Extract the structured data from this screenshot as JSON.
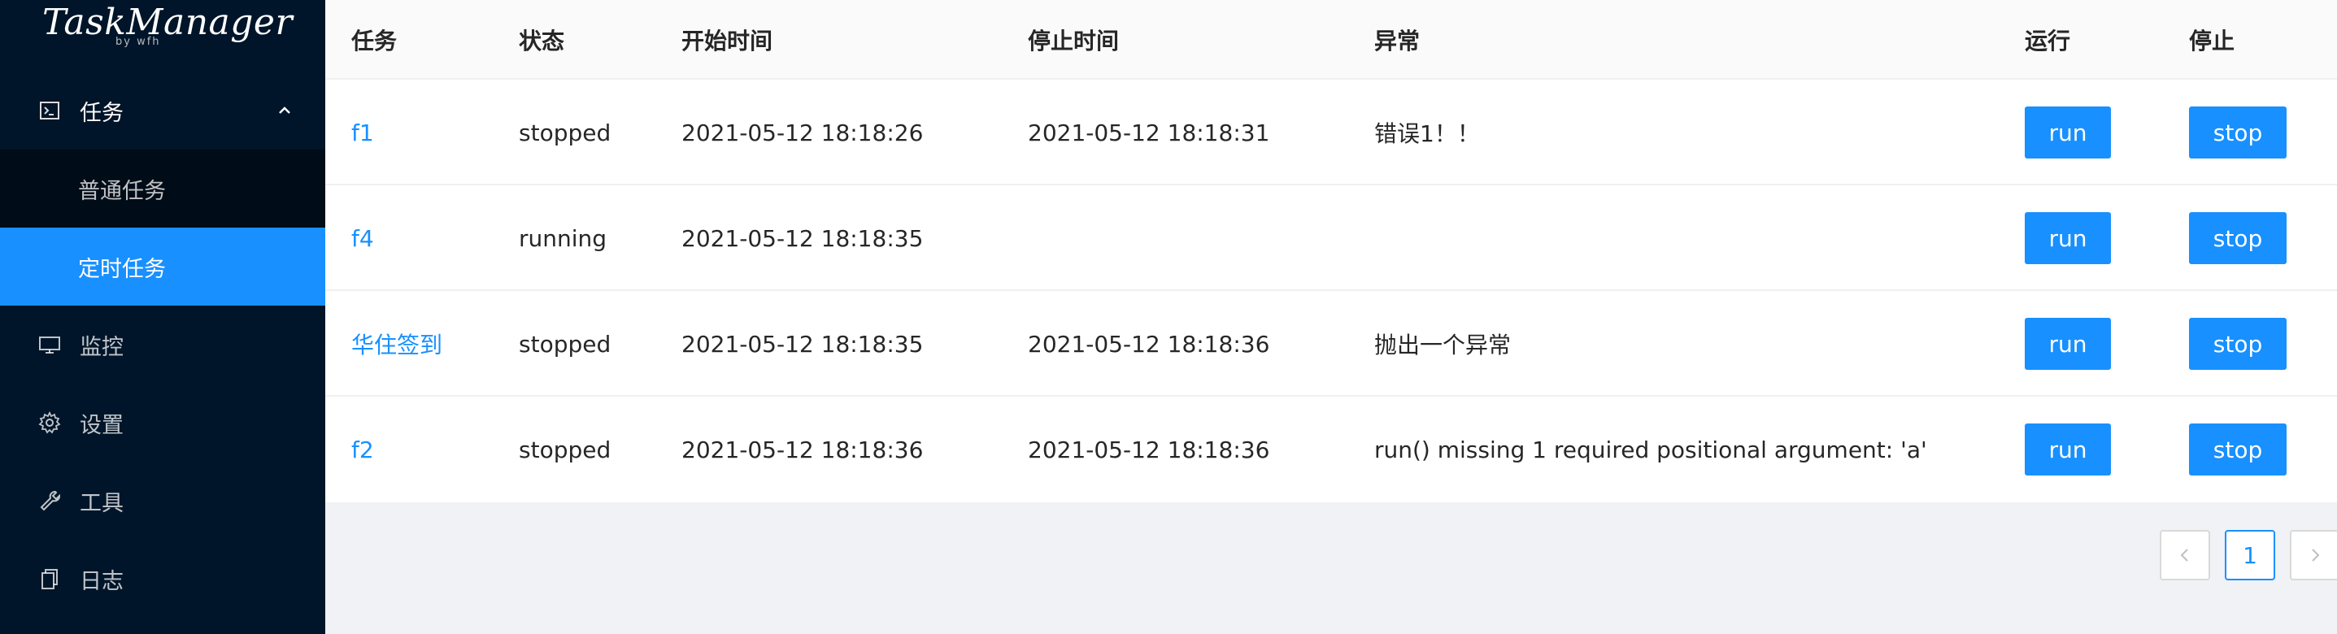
{
  "app": {
    "logo_title": "TaskManager",
    "logo_sub": "by wfh"
  },
  "sidebar": {
    "groups": [
      {
        "label": "任务",
        "icon": "terminal-icon",
        "expanded": true,
        "children": [
          {
            "label": "普通任务",
            "active": false
          },
          {
            "label": "定时任务",
            "active": true
          }
        ]
      },
      {
        "label": "监控",
        "icon": "desktop-icon"
      },
      {
        "label": "设置",
        "icon": "gear-icon"
      },
      {
        "label": "工具",
        "icon": "wrench-icon"
      },
      {
        "label": "日志",
        "icon": "copy-icon"
      }
    ]
  },
  "table": {
    "headers": [
      "任务",
      "状态",
      "开始时间",
      "停止时间",
      "异常",
      "运行",
      "停止"
    ],
    "rows": [
      {
        "task": "f1",
        "status": "stopped",
        "start": "2021-05-12 18:18:26",
        "stop": "2021-05-12 18:18:31",
        "error": "错误1！！",
        "run_label": "run",
        "stop_label": "stop"
      },
      {
        "task": "f4",
        "status": "running",
        "start": "2021-05-12 18:18:35",
        "stop": "",
        "error": "",
        "run_label": "run",
        "stop_label": "stop"
      },
      {
        "task": "华住签到",
        "status": "stopped",
        "start": "2021-05-12 18:18:35",
        "stop": "2021-05-12 18:18:36",
        "error": "抛出一个异常",
        "run_label": "run",
        "stop_label": "stop"
      },
      {
        "task": "f2",
        "status": "stopped",
        "start": "2021-05-12 18:18:36",
        "stop": "2021-05-12 18:18:36",
        "error": "run() missing 1 required positional argument: 'a'",
        "run_label": "run",
        "stop_label": "stop"
      }
    ]
  },
  "pagination": {
    "current": "1",
    "prev_icon": "chevron-left-icon",
    "next_icon": "chevron-right-icon"
  },
  "colors": {
    "sidebar_bg": "#001529",
    "submenu_bg": "#000c17",
    "accent": "#1890ff",
    "page_bg": "#f0f2f5"
  }
}
